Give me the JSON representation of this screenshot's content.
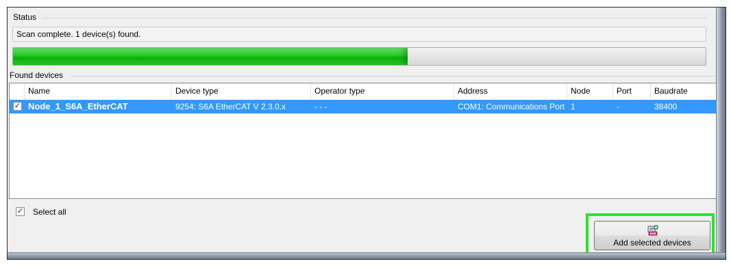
{
  "status": {
    "group_label": "Status",
    "message": "Scan complete. 1 device(s) found.",
    "progress_fraction": 0.57,
    "progress_color": "#06b006"
  },
  "found_devices": {
    "group_label": "Found devices",
    "columns": [
      "Name",
      "Device type",
      "Operator type",
      "Address",
      "Node",
      "Port",
      "Baudrate"
    ],
    "rows": [
      {
        "checked": true,
        "name": "Node_1_S6A_EtherCAT",
        "device_type": "9254: S6A EtherCAT V 2.3.0.x",
        "operator_type": "- - -",
        "address": "COM1: Communications Port",
        "node": "1",
        "port": "-",
        "baudrate": "38400"
      }
    ],
    "selection_color": "#3399ff"
  },
  "select_all": {
    "label": "Select all",
    "checked": true
  },
  "add_button": {
    "label": "Add selected devices",
    "icon": "add-device-icon"
  },
  "highlight_color": "#29e32b"
}
